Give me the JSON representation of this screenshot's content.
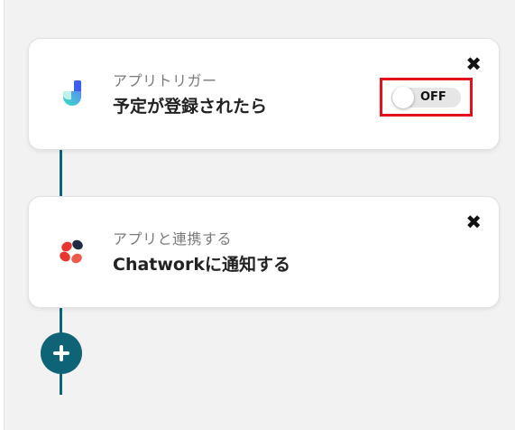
{
  "flow": {
    "trigger_card": {
      "icon": "jooto-app-icon",
      "subtitle": "アプリトリガー",
      "title": "予定が登録されたら",
      "close_icon": "close-icon",
      "toggle": {
        "label": "OFF",
        "state": "off",
        "highlight_color": "#e3111b"
      }
    },
    "action_card": {
      "icon": "chatwork-app-icon",
      "subtitle": "アプリと連携する",
      "title": "Chatworkに通知する",
      "close_icon": "close-icon"
    },
    "add_step": {
      "icon": "plus-icon"
    }
  },
  "colors": {
    "accent": "#0e6476",
    "panel_bg": "#f2f2f2",
    "card_bg": "#ffffff"
  }
}
